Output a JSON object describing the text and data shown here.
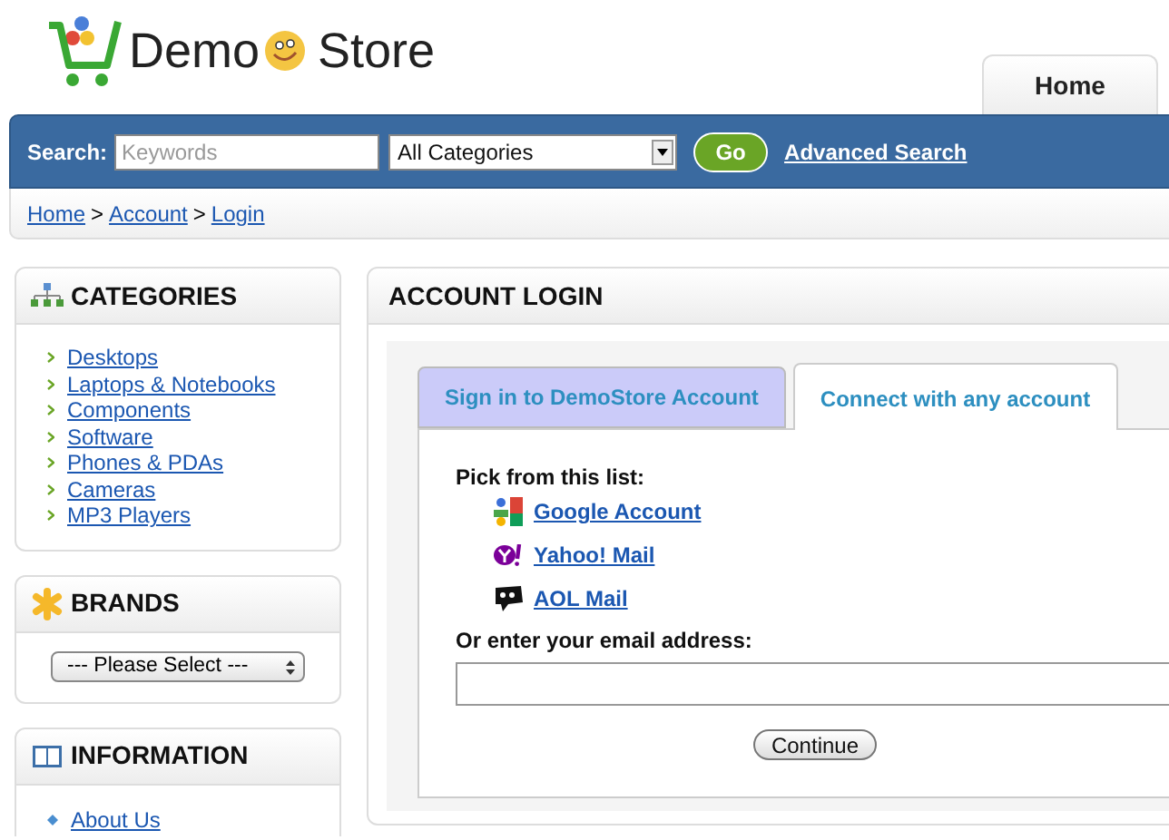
{
  "logo": {
    "part_1": "Demo",
    "part_2": "Store"
  },
  "nav_tabs": [
    {
      "label": "Home",
      "selected": true
    }
  ],
  "search": {
    "label": "Search:",
    "placeholder": "Keywords",
    "category": "All Categories",
    "button": "Go",
    "advanced_link": "Advanced Search"
  },
  "breadcrumb": [
    {
      "label": "Home"
    },
    {
      "label": "Account"
    },
    {
      "label": "Login"
    }
  ],
  "breadcrumb_separator": ">",
  "sidebar": [
    {
      "kind": "links",
      "title": "CATEGORIES",
      "items": [
        "Desktops",
        "Laptops & Notebooks",
        "Components",
        "Software",
        "Phones & PDAs",
        "Cameras",
        "MP3 Players"
      ]
    },
    {
      "kind": "select",
      "title": "BRANDS",
      "value": "--- Please Select ---"
    },
    {
      "kind": "info",
      "title": "INFORMATION",
      "items": [
        "About Us"
      ]
    }
  ],
  "panel": {
    "title": "ACCOUNT LOGIN",
    "tabs": [
      {
        "label": "Sign in to DemoStore Account",
        "selected": false
      },
      {
        "label": "Connect with any account",
        "selected": true
      }
    ],
    "pick_label": "Pick from this list:",
    "providers": [
      {
        "kind": "google",
        "label": "Google Account"
      },
      {
        "kind": "yahoo",
        "label": "Yahoo! Mail"
      },
      {
        "kind": "aol",
        "label": "AOL Mail"
      }
    ],
    "email_label": "Or enter your email address:",
    "button": "Continue"
  }
}
